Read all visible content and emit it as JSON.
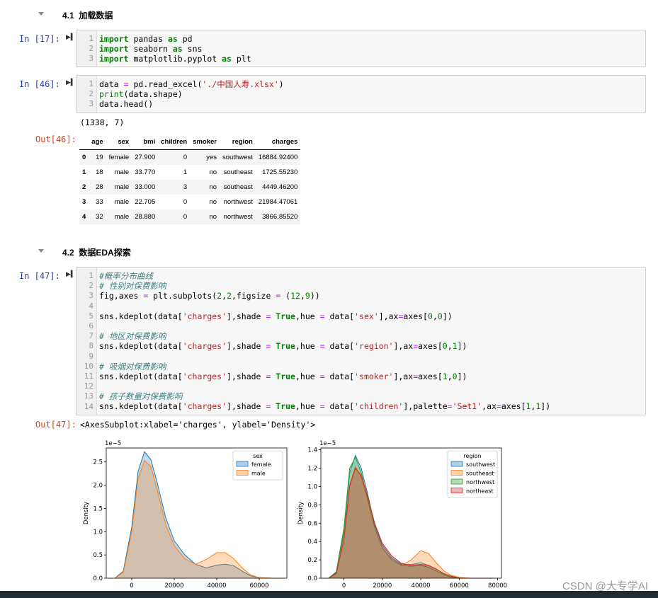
{
  "section1": {
    "number": "4.1",
    "title": "加载数据"
  },
  "section2": {
    "number": "4.2",
    "title": "数据EDA探索"
  },
  "cell17": {
    "prompt": "In [17]:",
    "lines": [
      "1",
      "2",
      "3"
    ],
    "code": [
      [
        {
          "t": "import",
          "c": "kw"
        },
        {
          "t": " pandas "
        },
        {
          "t": "as",
          "c": "kw"
        },
        {
          "t": " pd"
        }
      ],
      [
        {
          "t": "import",
          "c": "kw"
        },
        {
          "t": " seaborn "
        },
        {
          "t": "as",
          "c": "kw"
        },
        {
          "t": " sns"
        }
      ],
      [
        {
          "t": "import",
          "c": "kw"
        },
        {
          "t": " matplotlib.pyplot "
        },
        {
          "t": "as",
          "c": "kw"
        },
        {
          "t": " plt"
        }
      ]
    ]
  },
  "cell46": {
    "prompt": "In [46]:",
    "out_prompt": "Out[46]:",
    "lines": [
      "1",
      "2",
      "3"
    ],
    "code": [
      [
        {
          "t": "data "
        },
        {
          "t": "=",
          "c": "op"
        },
        {
          "t": " pd.read_excel("
        },
        {
          "t": "'./中国人寿.xlsx'",
          "c": "str"
        },
        {
          "t": ")"
        }
      ],
      [
        {
          "t": "print",
          "c": "bi"
        },
        {
          "t": "(data.shape)"
        }
      ],
      [
        {
          "t": "data.head()"
        }
      ]
    ],
    "stdout": "(1338, 7)",
    "table": {
      "columns": [
        "",
        "age",
        "sex",
        "bmi",
        "children",
        "smoker",
        "region",
        "charges"
      ],
      "rows": [
        [
          "0",
          "19",
          "female",
          "27.900",
          "0",
          "yes",
          "southwest",
          "16884.92400"
        ],
        [
          "1",
          "18",
          "male",
          "33.770",
          "1",
          "no",
          "southeast",
          "1725.55230"
        ],
        [
          "2",
          "28",
          "male",
          "33.000",
          "3",
          "no",
          "southeast",
          "4449.46200"
        ],
        [
          "3",
          "33",
          "male",
          "22.705",
          "0",
          "no",
          "northwest",
          "21984.47061"
        ],
        [
          "4",
          "32",
          "male",
          "28.880",
          "0",
          "no",
          "northwest",
          "3866.85520"
        ]
      ]
    }
  },
  "cell47": {
    "prompt": "In [47]:",
    "out_prompt": "Out[47]:",
    "lines": [
      "1",
      "2",
      "3",
      "4",
      "5",
      "6",
      "7",
      "8",
      "9",
      "10",
      "11",
      "12",
      "13",
      "14"
    ],
    "code": [
      [
        {
          "t": "#概率分布曲线",
          "c": "cm"
        }
      ],
      [
        {
          "t": "# 性别对保费影响",
          "c": "cm"
        }
      ],
      [
        {
          "t": "fig,axes "
        },
        {
          "t": "=",
          "c": "op"
        },
        {
          "t": " plt.subplots("
        },
        {
          "t": "2",
          "c": "num"
        },
        {
          "t": ","
        },
        {
          "t": "2",
          "c": "num"
        },
        {
          "t": ",figsize "
        },
        {
          "t": "=",
          "c": "op"
        },
        {
          "t": " ("
        },
        {
          "t": "12",
          "c": "num"
        },
        {
          "t": ","
        },
        {
          "t": "9",
          "c": "num"
        },
        {
          "t": "))"
        }
      ],
      [],
      [
        {
          "t": "sns.kdeplot(data["
        },
        {
          "t": "'charges'",
          "c": "str"
        },
        {
          "t": "],shade "
        },
        {
          "t": "=",
          "c": "op"
        },
        {
          "t": " "
        },
        {
          "t": "True",
          "c": "kw"
        },
        {
          "t": ",hue "
        },
        {
          "t": "=",
          "c": "op"
        },
        {
          "t": " data["
        },
        {
          "t": "'sex'",
          "c": "str"
        },
        {
          "t": "],ax"
        },
        {
          "t": "=",
          "c": "op"
        },
        {
          "t": "axes["
        },
        {
          "t": "0",
          "c": "num"
        },
        {
          "t": ","
        },
        {
          "t": "0",
          "c": "num"
        },
        {
          "t": "])"
        }
      ],
      [],
      [
        {
          "t": "# 地区对保费影响",
          "c": "cm"
        }
      ],
      [
        {
          "t": "sns.kdeplot(data["
        },
        {
          "t": "'charges'",
          "c": "str"
        },
        {
          "t": "],shade "
        },
        {
          "t": "=",
          "c": "op"
        },
        {
          "t": " "
        },
        {
          "t": "True",
          "c": "kw"
        },
        {
          "t": ",hue "
        },
        {
          "t": "=",
          "c": "op"
        },
        {
          "t": " data["
        },
        {
          "t": "'region'",
          "c": "str"
        },
        {
          "t": "],ax"
        },
        {
          "t": "=",
          "c": "op"
        },
        {
          "t": "axes["
        },
        {
          "t": "0",
          "c": "num"
        },
        {
          "t": ","
        },
        {
          "t": "1",
          "c": "num"
        },
        {
          "t": "])"
        }
      ],
      [],
      [
        {
          "t": "# 吸烟对保费影响",
          "c": "cm"
        }
      ],
      [
        {
          "t": "sns.kdeplot(data["
        },
        {
          "t": "'charges'",
          "c": "str"
        },
        {
          "t": "],shade "
        },
        {
          "t": "=",
          "c": "op"
        },
        {
          "t": " "
        },
        {
          "t": "True",
          "c": "kw"
        },
        {
          "t": ",hue "
        },
        {
          "t": "=",
          "c": "op"
        },
        {
          "t": " data["
        },
        {
          "t": "'smoker'",
          "c": "str"
        },
        {
          "t": "],ax"
        },
        {
          "t": "=",
          "c": "op"
        },
        {
          "t": "axes["
        },
        {
          "t": "1",
          "c": "num"
        },
        {
          "t": ","
        },
        {
          "t": "0",
          "c": "num"
        },
        {
          "t": "])"
        }
      ],
      [],
      [
        {
          "t": "# 孩子数量对保费影响",
          "c": "cm"
        }
      ],
      [
        {
          "t": "sns.kdeplot(data["
        },
        {
          "t": "'charges'",
          "c": "str"
        },
        {
          "t": "],shade "
        },
        {
          "t": "=",
          "c": "op"
        },
        {
          "t": " "
        },
        {
          "t": "True",
          "c": "kw"
        },
        {
          "t": ",hue "
        },
        {
          "t": "=",
          "c": "op"
        },
        {
          "t": " data["
        },
        {
          "t": "'children'",
          "c": "str"
        },
        {
          "t": "],palette"
        },
        {
          "t": "=",
          "c": "op"
        },
        {
          "t": "'Set1'",
          "c": "str"
        },
        {
          "t": ",ax"
        },
        {
          "t": "=",
          "c": "op"
        },
        {
          "t": "axes["
        },
        {
          "t": "1",
          "c": "num"
        },
        {
          "t": ","
        },
        {
          "t": "1",
          "c": "num"
        },
        {
          "t": "])"
        }
      ]
    ],
    "result_text": "<AxesSubplot:xlabel='charges', ylabel='Density'>"
  },
  "chart_data": [
    {
      "type": "area",
      "title": "",
      "ylabel": "Density",
      "xlabel": "",
      "y_scale_label": "1e−5",
      "xlim": [
        -12000,
        73000
      ],
      "ylim": [
        0,
        2.8
      ],
      "xticks": [
        0,
        20000,
        40000,
        60000
      ],
      "yticks": [
        0.0,
        0.5,
        1.0,
        1.5,
        2.0,
        2.5
      ],
      "ytick_labels": [
        "0.0",
        "0.5",
        "1.0",
        "1.5",
        "2.0",
        "2.5"
      ],
      "legend": {
        "title": "sex",
        "placement": "top-right"
      },
      "x": [
        -8000,
        -4000,
        0,
        3000,
        6000,
        9000,
        12000,
        16000,
        20000,
        25000,
        30000,
        35000,
        40000,
        44000,
        48000,
        52000,
        56000,
        60000,
        66000,
        72000
      ],
      "series": [
        {
          "name": "female",
          "color": "#1f77b4",
          "values": [
            0.0,
            0.15,
            1.1,
            2.3,
            2.72,
            2.55,
            2.05,
            1.3,
            0.8,
            0.5,
            0.3,
            0.22,
            0.28,
            0.3,
            0.27,
            0.15,
            0.05,
            0.01,
            0.0,
            0.0
          ]
        },
        {
          "name": "male",
          "color": "#ff7f0e",
          "values": [
            0.0,
            0.12,
            1.0,
            2.15,
            2.53,
            2.4,
            1.9,
            1.15,
            0.7,
            0.42,
            0.3,
            0.4,
            0.55,
            0.55,
            0.42,
            0.22,
            0.07,
            0.01,
            0.0,
            0.0
          ]
        }
      ]
    },
    {
      "type": "area",
      "title": "",
      "ylabel": "Density",
      "xlabel": "",
      "y_scale_label": "1e−5",
      "xlim": [
        -12000,
        82000
      ],
      "ylim": [
        0,
        1.42
      ],
      "xticks": [
        0,
        20000,
        40000,
        60000,
        80000
      ],
      "yticks": [
        0.0,
        0.2,
        0.4,
        0.6,
        0.8,
        1.0,
        1.2,
        1.4
      ],
      "ytick_labels": [
        "0.0",
        "0.2",
        "0.4",
        "0.6",
        "0.8",
        "1.0",
        "1.2",
        "1.4"
      ],
      "legend": {
        "title": "region",
        "placement": "top-right"
      },
      "x": [
        -8000,
        -4000,
        0,
        3000,
        6000,
        9000,
        12000,
        16000,
        20000,
        25000,
        30000,
        35000,
        40000,
        44000,
        48000,
        52000,
        56000,
        60000,
        66000,
        72000,
        78000
      ],
      "series": [
        {
          "name": "southwest",
          "color": "#1f77b4",
          "values": [
            0.0,
            0.06,
            0.5,
            1.15,
            1.34,
            1.2,
            0.95,
            0.58,
            0.36,
            0.22,
            0.15,
            0.15,
            0.17,
            0.14,
            0.1,
            0.05,
            0.02,
            0.0,
            0.0,
            0.0,
            0.0
          ]
        },
        {
          "name": "southeast",
          "color": "#ff7f0e",
          "values": [
            0.0,
            0.05,
            0.45,
            1.02,
            1.22,
            1.1,
            0.88,
            0.55,
            0.33,
            0.2,
            0.14,
            0.2,
            0.3,
            0.27,
            0.17,
            0.08,
            0.03,
            0.01,
            0.0,
            0.0,
            0.0
          ]
        },
        {
          "name": "northwest",
          "color": "#2ca02c",
          "values": [
            0.0,
            0.07,
            0.55,
            1.2,
            1.32,
            1.15,
            0.9,
            0.55,
            0.33,
            0.2,
            0.14,
            0.13,
            0.14,
            0.12,
            0.08,
            0.04,
            0.01,
            0.0,
            0.0,
            0.0,
            0.0
          ]
        },
        {
          "name": "northeast",
          "color": "#d62728",
          "values": [
            0.0,
            0.05,
            0.42,
            1.0,
            1.2,
            1.12,
            0.92,
            0.6,
            0.38,
            0.24,
            0.16,
            0.14,
            0.15,
            0.14,
            0.1,
            0.05,
            0.02,
            0.0,
            0.0,
            0.0,
            0.0
          ]
        }
      ]
    }
  ],
  "watermark": "CSDN @大专学AI"
}
